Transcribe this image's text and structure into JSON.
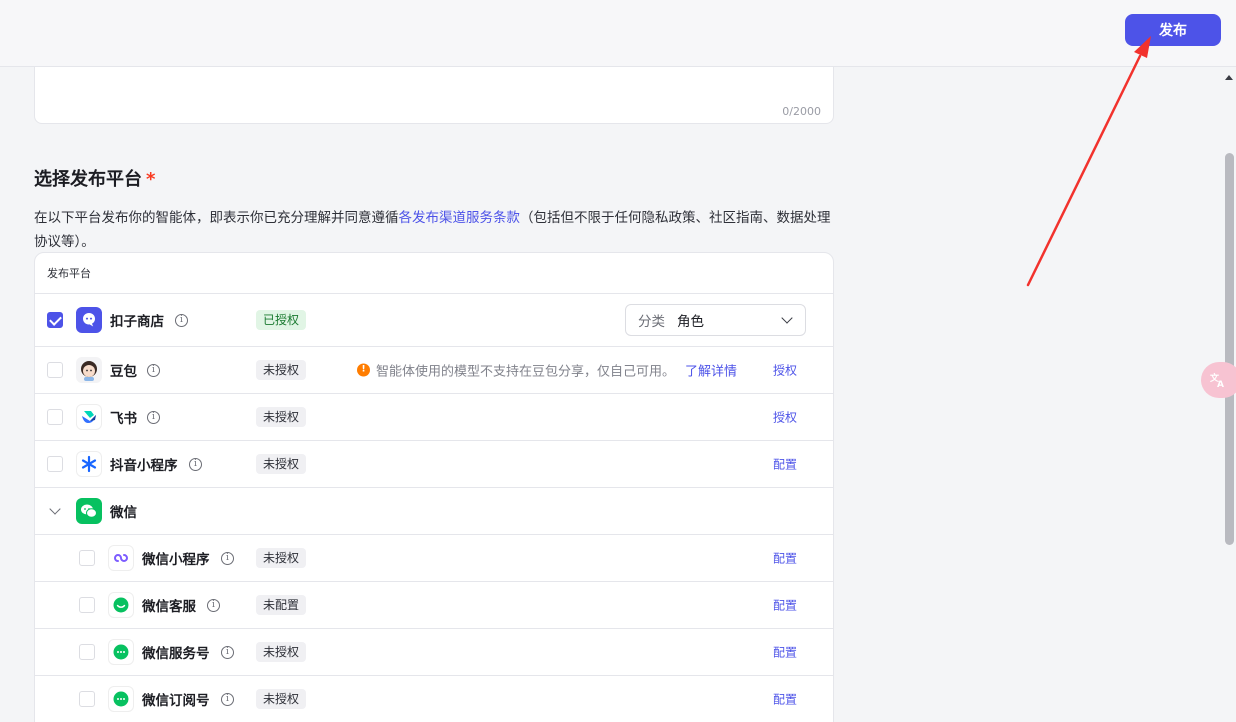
{
  "header": {
    "publish_label": "发布"
  },
  "description_field": {
    "char_count": "0/2000"
  },
  "platform_section": {
    "title": "选择发布平台",
    "required_mark": "*",
    "desc_prefix": "在以下平台发布你的智能体，即表示你已充分理解并同意遵循",
    "desc_link": "各发布渠道服务条款",
    "desc_suffix": "（包括但不限于任何隐私政策、社区指南、数据处理协议等）。",
    "table_header": "发布平台"
  },
  "rows": {
    "kouzi": {
      "name": "扣子商店",
      "status": "已授权",
      "select_label": "分类",
      "select_value": "角色",
      "checked": true
    },
    "doubao": {
      "name": "豆包",
      "status": "未授权",
      "warning": "智能体使用的模型不支持在豆包分享，仅自己可用。",
      "warning_link": "了解详情",
      "action": "授权"
    },
    "feishu": {
      "name": "飞书",
      "status": "未授权",
      "action": "授权"
    },
    "douyin": {
      "name": "抖音小程序",
      "status": "未授权",
      "action": "配置"
    },
    "wechat_group": {
      "name": "微信"
    },
    "wx_mini": {
      "name": "微信小程序",
      "status": "未授权",
      "action": "配置"
    },
    "wx_service": {
      "name": "微信客服",
      "status": "未配置",
      "action": "配置"
    },
    "wx_official": {
      "name": "微信服务号",
      "status": "未授权",
      "action": "配置"
    },
    "wx_subscribe": {
      "name": "微信订阅号",
      "status": "未授权",
      "action": "配置"
    }
  },
  "floating": {
    "translate_icon": "translate-icon"
  },
  "colors": {
    "accent": "#4d53e8",
    "authorized_bg": "#e1f5e5",
    "warning": "#ff7d00",
    "annotation_arrow": "#f2322d"
  }
}
